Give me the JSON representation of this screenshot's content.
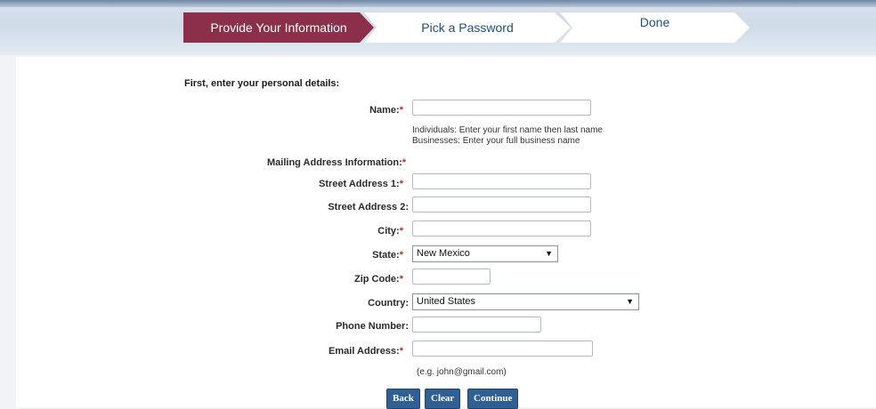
{
  "steps": [
    {
      "label": "Provide Your Information"
    },
    {
      "label": "Pick a Password"
    },
    {
      "label": "Done"
    }
  ],
  "form": {
    "intro": "First, enter your personal details:",
    "required_mark": "*",
    "name": {
      "label": "Name:",
      "value": ""
    },
    "name_hint_1": "Individuals: Enter your first name then last name",
    "name_hint_2": "Businesses: Enter your full business name",
    "mailing_label": "Mailing Address Information:",
    "street1": {
      "label": "Street Address 1:",
      "value": ""
    },
    "street2": {
      "label": "Street Address 2:",
      "value": ""
    },
    "city": {
      "label": "City:",
      "value": ""
    },
    "state": {
      "label": "State:",
      "value": "New Mexico"
    },
    "zip": {
      "label": "Zip Code:",
      "value": ""
    },
    "country": {
      "label": "Country:",
      "value": "United States"
    },
    "phone": {
      "label": "Phone Number:",
      "value": ""
    },
    "email": {
      "label": "Email Address:",
      "value": ""
    },
    "email_hint": "(e.g. john@gmail.com)"
  },
  "buttons": {
    "back": "Back",
    "clear": "Clear",
    "continue": "Continue"
  },
  "colors": {
    "active_step": "#8b2f4a",
    "inactive_step": "#ffffff",
    "button": "#2f5f93",
    "required": "#d0202a"
  },
  "icons": {
    "dropdown": "triangle-down"
  }
}
